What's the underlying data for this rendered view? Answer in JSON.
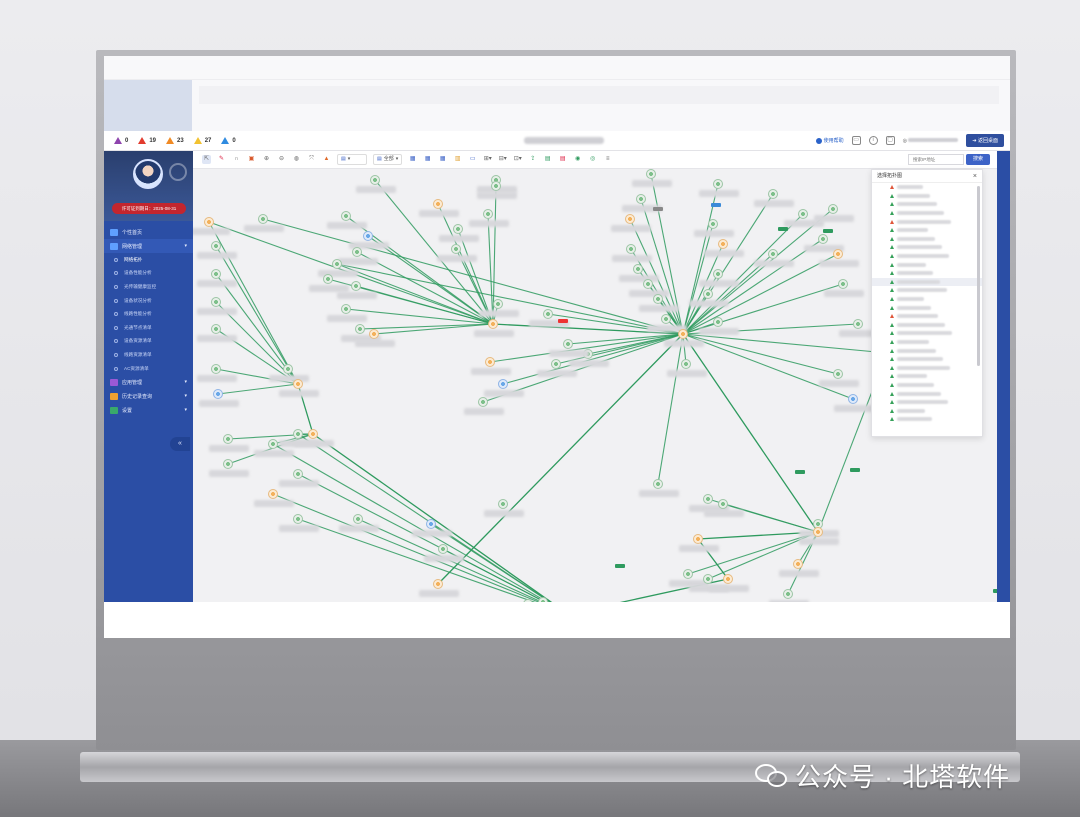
{
  "topbar": {
    "alarms": [
      {
        "count": "0",
        "color": "#8e44ad",
        "icon": "alarm-critical-icon"
      },
      {
        "count": "19",
        "color": "#e23b2e",
        "icon": "alarm-major-icon"
      },
      {
        "count": "23",
        "color": "#f08a24",
        "icon": "alarm-minor-icon"
      },
      {
        "count": "27",
        "color": "#f2c230",
        "icon": "alarm-warning-icon"
      },
      {
        "count": "0",
        "color": "#2f8be0",
        "icon": "alarm-info-icon"
      }
    ],
    "help_label": "使用帮助",
    "back_button": "返回桌面"
  },
  "sidebar": {
    "license_label": "许可证到期日：2025-08-31",
    "menu": [
      {
        "label": "个性首页",
        "icon": "home-icon",
        "active": false,
        "has_caret": false
      },
      {
        "label": "网络管理",
        "icon": "network-icon",
        "active": true,
        "has_caret": true
      }
    ],
    "submenu": [
      {
        "label": "网络拓扑",
        "active": true
      },
      {
        "label": "设备性能分析",
        "active": false
      },
      {
        "label": "光传输健康监控",
        "active": false
      },
      {
        "label": "设备状况分析",
        "active": false
      },
      {
        "label": "线路性能分析",
        "active": false
      },
      {
        "label": "光通节点清单",
        "active": false
      },
      {
        "label": "设备资源清单",
        "active": false
      },
      {
        "label": "线路资源清单",
        "active": false
      },
      {
        "label": "AC资源清单",
        "active": false
      }
    ],
    "menu_bottom": [
      {
        "label": "应用管理",
        "icon": "app-icon",
        "color": "#9b59d6"
      },
      {
        "label": "历史记录查询",
        "icon": "history-icon",
        "color": "#f0a030"
      },
      {
        "label": "设置",
        "icon": "settings-icon",
        "color": "#39a96b"
      }
    ],
    "collapse_label": "«"
  },
  "toolbar": {
    "select_label": "全部",
    "search_placeholder": "搜索IP地址",
    "search_button": "搜索"
  },
  "popup": {
    "title": "选择拓扑图",
    "close": "×",
    "rows": 28
  },
  "watermark": {
    "text": "公众号 · 北塔软件"
  },
  "colors": {
    "sidebar": "#2b4ea5",
    "link": "#2e9a5e",
    "accent": "#3d63c7"
  }
}
